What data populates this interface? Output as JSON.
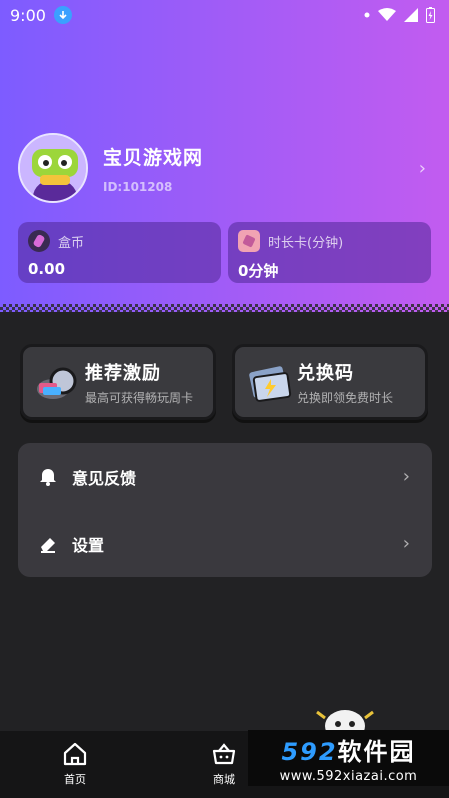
{
  "status_bar": {
    "time": "9:00"
  },
  "profile": {
    "name": "宝贝游戏网",
    "uid": "ID:101208",
    "arrow": "›"
  },
  "balances": [
    {
      "label": "盒币",
      "value": "0.00"
    },
    {
      "label": "时长卡(分钟)",
      "value": "0分钟"
    }
  ],
  "promos": [
    {
      "title": "推荐激励",
      "subtitle": "最高可获得畅玩周卡"
    },
    {
      "title": "兑换码",
      "subtitle": "兑换即领免费时长"
    }
  ],
  "menu": [
    {
      "label": "意见反馈",
      "icon": "bell-icon",
      "arrow": "›"
    },
    {
      "label": "设置",
      "icon": "eraser-icon",
      "arrow": "›"
    }
  ],
  "tabs": [
    {
      "label": "首页",
      "icon": "home-icon"
    },
    {
      "label": "商城",
      "icon": "shop-basket-icon"
    }
  ],
  "watermark": {
    "num": "592",
    "cn": "软件园",
    "url": "www.592xiazai.com"
  },
  "colors": {
    "header_start": "#7d5cff",
    "header_end": "#c25cf0",
    "background": "#222224",
    "card": "#3a393e",
    "accent_blue": "#2e9cff"
  }
}
